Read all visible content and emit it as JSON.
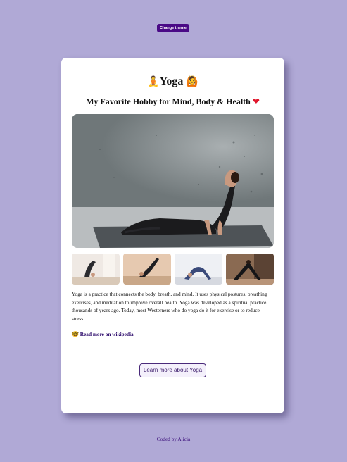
{
  "theme_button": {
    "label": "Change theme"
  },
  "card": {
    "title": "Yoga",
    "title_emoji_left": "🧘",
    "title_emoji_right": "🙆",
    "subtitle": "My Favorite Hobby for Mind, Body & Health",
    "subtitle_emoji": "❤",
    "description": "Yoga is a practice that connects the body, breath, and mind. It uses physical postures, breathing exercises, and meditation to improve overall health. Yoga was developed as a spiritual practice thousands of years ago. Today, most Westerners who do yoga do it for exercise or to reduce stress.",
    "wiki_emoji": "🤓",
    "wiki_link": "Read more on wikipedia",
    "learn_button": "Learn more about Yoga"
  },
  "footer": {
    "link": "Coded by Alicia"
  },
  "colors": {
    "background": "#b0a9d6",
    "theme_button": "#4a0a86",
    "link": "#2c0a6b"
  }
}
